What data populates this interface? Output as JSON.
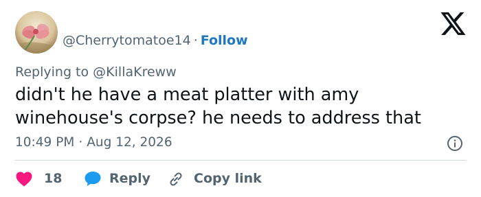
{
  "tweet": {
    "handle": "@Cherrytomatoe14",
    "separator": "·",
    "follow_label": "Follow",
    "replying_prefix": "Replying to",
    "replying_to": "@KillaKreww",
    "text_lines": [
      "didn't he have a meat platter with amy",
      "winehouse's corpse? he needs to address that"
    ],
    "time": "10:49 PM",
    "meta_separator": "·",
    "date": "Aug 12, 2026",
    "likes": "18",
    "reply_label": "Reply",
    "copy_link_label": "Copy link"
  },
  "icons": {
    "brand": "x-logo-icon",
    "info": "info-icon",
    "like": "heart-icon",
    "reply": "speech-bubble-icon",
    "copy": "link-icon"
  },
  "colors": {
    "text": "#0f1419",
    "secondary": "#536471",
    "link": "#1d78c1",
    "heart": "#f91880",
    "reply_bubble": "#1d9bf0",
    "divider": "#cfd9de"
  }
}
